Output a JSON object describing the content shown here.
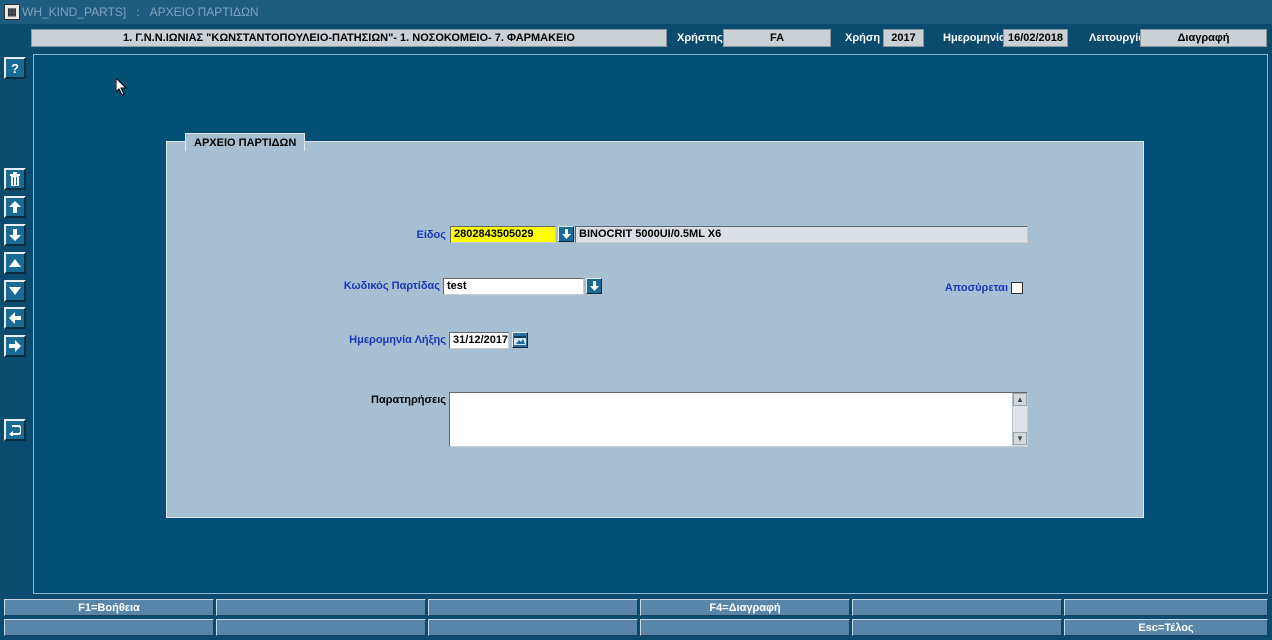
{
  "window": {
    "form_name": "WH_KIND_PARTS]",
    "title": "ΑΡΧΕΙΟ ΠΑΡΤΙΔΩΝ"
  },
  "header": {
    "organization": "1. Γ.Ν.Ν.ΙΩΝΙΑΣ \"ΚΩΝΣΤΑΝΤΟΠΟΥΛΕΙΟ-ΠΑΤΗΣΙΩΝ\"- 1. ΝΟΣΟΚΟΜΕΙΟ- 7. ΦΑΡΜΑΚΕΙΟ",
    "user_label": "Χρήστης",
    "user_value": "FA",
    "year_label": "Χρήση",
    "year_value": "2017",
    "date_label": "Ημερομηνία",
    "date_value": "16/02/2018",
    "mode_label": "Λειτουργία",
    "mode_value": "Διαγραφή"
  },
  "toolbar": {
    "help": "?",
    "buttons": [
      "trash-icon",
      "arrow-up-icon",
      "arrow-down-icon",
      "triangle-up-icon",
      "triangle-down-icon",
      "arrow-left-icon",
      "arrow-right-icon",
      "undo-icon"
    ]
  },
  "panel": {
    "tab_label": "ΑΡΧΕΙΟ ΠΑΡΤΙΔΩΝ",
    "item_label": "Είδος",
    "item_code": "2802843505029",
    "item_description": "BINOCRIT 5000UI/0.5ML X6",
    "batch_label": "Κωδικός Παρτίδας",
    "batch_value": "test",
    "withdrawn_label": "Αποσύρεται",
    "expiry_label": "Ημερομηνία Λήξης",
    "expiry_value": "31/12/2017",
    "notes_label": "Παρατηρήσεις",
    "notes_value": ""
  },
  "fkeys": {
    "row1": [
      "F1=Βοήθεια",
      "",
      "",
      "F4=Διαγραφή",
      "",
      ""
    ],
    "row2": [
      "",
      "",
      "",
      "",
      "",
      "Esc=Τέλος"
    ]
  },
  "colors": {
    "background": "#0b4b6e",
    "panel": "#a7bfd3",
    "label_blue": "#1a37b8",
    "highlight": "#ffff00",
    "fkey": "#5986a8"
  }
}
